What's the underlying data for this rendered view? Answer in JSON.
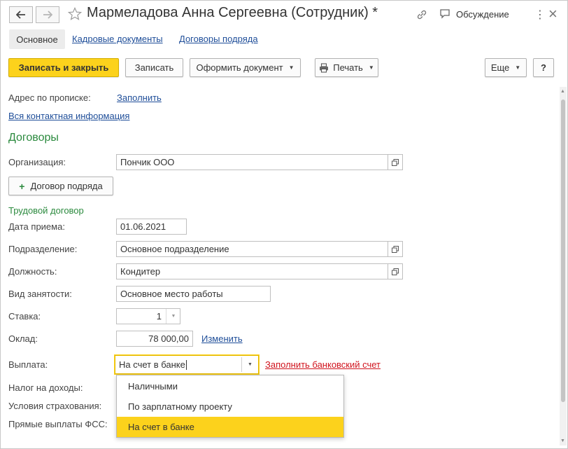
{
  "window": {
    "title": "Мармеладова Анна Сергеевна (Сотрудник) *",
    "discussion_label": "Обсуждение",
    "more_glyph": "⋮",
    "close_glyph": "×"
  },
  "tabs": [
    {
      "label": "Основное",
      "active": true
    },
    {
      "label": "Кадровые документы",
      "active": false
    },
    {
      "label": "Договоры подряда",
      "active": false
    }
  ],
  "toolbar": {
    "save_close_label": "Записать и закрыть",
    "save_label": "Записать",
    "create_doc_label": "Оформить документ",
    "print_label": "Печать",
    "more_label": "Еще",
    "help_label": "?"
  },
  "form": {
    "address_label": "Адрес по прописке:",
    "address_fill_link": "Заполнить",
    "all_contacts_link": "Вся контактная информация",
    "contracts_section_title": "Договоры",
    "organization_label": "Организация:",
    "organization_value": "Пончик ООО",
    "add_contract_label": "Договор подряда",
    "labor_contract_title": "Трудовой договор",
    "hire_date_label": "Дата приема:",
    "hire_date_value": "01.06.2021",
    "department_label": "Подразделение:",
    "department_value": "Основное подразделение",
    "position_label": "Должность:",
    "position_value": "Кондитер",
    "employment_type_label": "Вид занятости:",
    "employment_type_value": "Основное место работы",
    "rate_label": "Ставка:",
    "rate_value": "1",
    "salary_label": "Оклад:",
    "salary_value": "78 000,00",
    "salary_change_link": "Изменить",
    "payment_label": "Выплата:",
    "payment_value": "На счет в банке",
    "fill_bank_account_link": "Заполнить банковский счет",
    "income_tax_label": "Налог на доходы:",
    "insurance_label": "Условия страхования:",
    "fss_label": "Прямые выплаты ФСС:"
  },
  "payment_dropdown": {
    "options": [
      "Наличными",
      "По зарплатному проекту",
      "На счет в банке"
    ],
    "selected": "На счет в банке"
  },
  "colors": {
    "accent": "#fcd21c",
    "link": "#1f4e99",
    "section": "#2b8a3e",
    "warning_link": "#d0131d"
  }
}
